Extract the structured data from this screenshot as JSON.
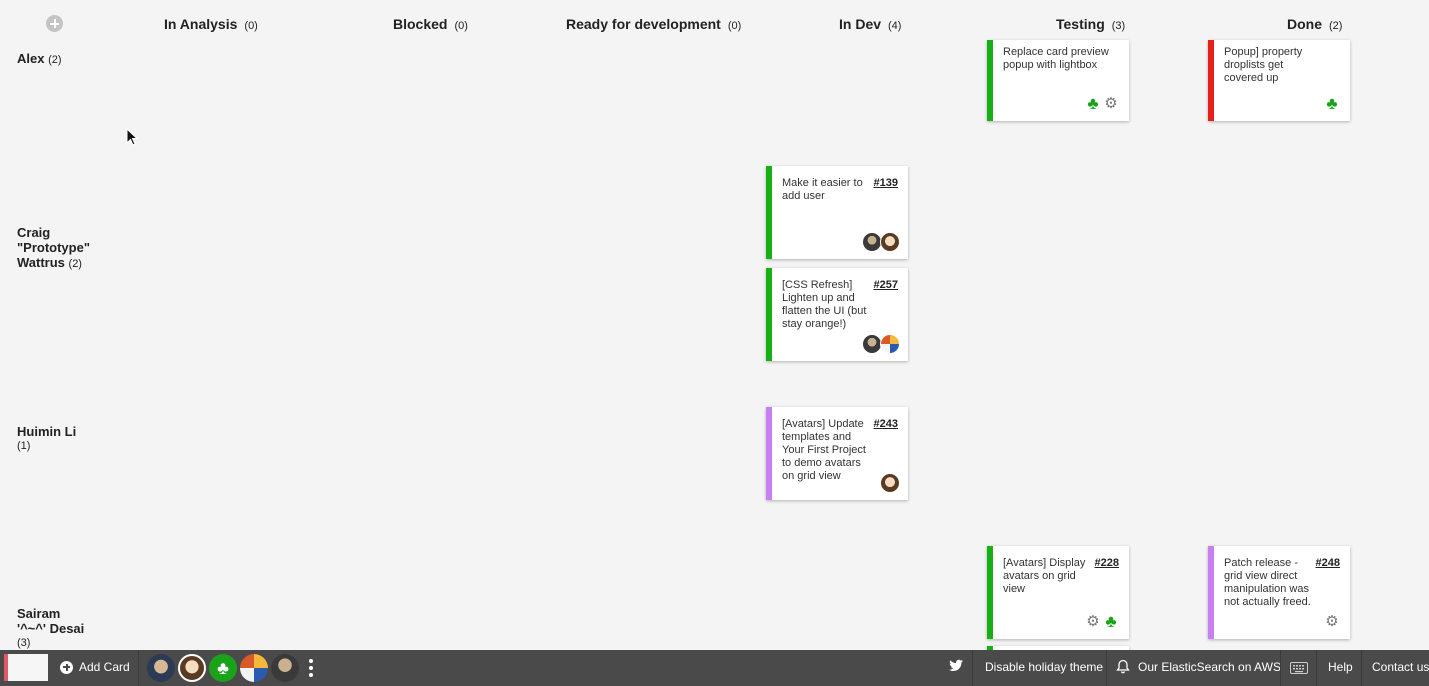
{
  "header": {
    "add_column_icon": "plus-circle-icon",
    "columns": [
      {
        "name": "In Analysis",
        "count": "(0)"
      },
      {
        "name": "Blocked",
        "count": "(0)"
      },
      {
        "name": "Ready for development",
        "count": "(0)"
      },
      {
        "name": "In Dev",
        "count": "(4)"
      },
      {
        "name": "Testing",
        "count": "(3)"
      },
      {
        "name": "Done",
        "count": "(2)"
      }
    ]
  },
  "lanes": [
    {
      "name": "Alex",
      "count": "(2)"
    },
    {
      "name_lines": [
        "Craig",
        "\"Prototype\"",
        "Wattrus"
      ],
      "count": "(2)"
    },
    {
      "name": "Huimin Li",
      "count": "(1)"
    },
    {
      "name_lines": [
        "Sairam",
        "'^~^' Desai"
      ],
      "count": "(3)"
    }
  ],
  "cards": {
    "alex_testing": {
      "title": "Replace card preview popup with lightbox",
      "number": "",
      "bar_color": "#14b014",
      "avatars": [
        "clover-icon",
        "robot-icon"
      ]
    },
    "alex_done": {
      "title": "Popup] property droplists get covered up",
      "number": "",
      "bar_color": "#e8201a",
      "avatars": [
        "clover-icon"
      ]
    },
    "craig_dev_1": {
      "title": "Make it easier to add user",
      "number": "#139",
      "bar_color": "#14b014",
      "avatars": [
        "user-avatar-dark",
        "user-avatar-glasses"
      ]
    },
    "craig_dev_2": {
      "title": "[CSS Refresh] Lighten up and flatten the UI (but stay orange!)",
      "number": "#257",
      "bar_color": "#14b014",
      "avatars": [
        "user-avatar-dark",
        "user-avatar-colorful"
      ]
    },
    "huimin_dev": {
      "title": "[Avatars] Update templates and Your First Project to demo avatars on grid view",
      "number": "#243",
      "bar_color": "#c77ff2",
      "avatars": [
        "user-avatar-glasses"
      ]
    },
    "sairam_testing_1": {
      "title": "[Avatars] Display avatars on grid view",
      "number": "#228",
      "bar_color": "#14b014",
      "avatars": [
        "robot-icon",
        "clover-icon"
      ]
    },
    "sairam_done": {
      "title": "Patch release - grid view direct manipulation was not actually freed.",
      "number": "#248",
      "bar_color": "#c77ff2",
      "avatars": [
        "robot-icon"
      ]
    }
  },
  "toolbar": {
    "add_card_label": "Add Card",
    "disable_theme_label": "Disable holiday theme",
    "notification_label": "Our ElasticSearch on AWS",
    "help_label": "Help",
    "contact_label": "Contact us"
  }
}
